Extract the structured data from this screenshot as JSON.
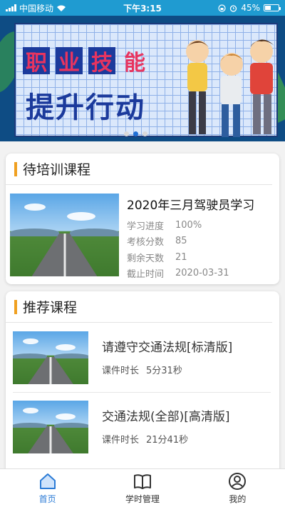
{
  "status_bar": {
    "carrier": "中国移动",
    "time": "下午3:15",
    "battery_percent": "45%",
    "battery_level": 0.45,
    "icons": [
      "signal-icon",
      "wifi-icon",
      "screen-lock-icon",
      "alarm-icon",
      "battery-icon"
    ]
  },
  "banner": {
    "title_line1_chars": [
      "职",
      "业",
      "技",
      "能"
    ],
    "title_line2": "提升行动",
    "carousel_pages": 3,
    "carousel_active": 2
  },
  "pending": {
    "section_title": "待培训课程",
    "course": {
      "title": "2020年三月驾驶员学习",
      "rows": [
        {
          "label": "学习进度",
          "value": "100%"
        },
        {
          "label": "考核分数",
          "value": "85"
        },
        {
          "label": "剩余天数",
          "value": "21"
        },
        {
          "label": "截止时间",
          "value": "2020-03-31"
        }
      ]
    }
  },
  "recommend": {
    "section_title": "推荐课程",
    "items": [
      {
        "title": "请遵守交通法规[标清版]",
        "duration_label": "课件时长",
        "duration": "5分31秒"
      },
      {
        "title": "交通法规(全部)[高清版]",
        "duration_label": "课件时长",
        "duration": "21分41秒"
      }
    ]
  },
  "tabbar": {
    "tabs": [
      {
        "label": "首页",
        "icon": "home-icon",
        "active": true
      },
      {
        "label": "学时管理",
        "icon": "book-icon",
        "active": false
      },
      {
        "label": "我的",
        "icon": "profile-icon",
        "active": false
      }
    ]
  },
  "colors": {
    "status_bar": "#1f9bd1",
    "accent_bar": "#f0a020",
    "tab_active": "#2b7bd6",
    "banner_title": "#1b3a9c",
    "banner_title_box_text": "#e8345f"
  }
}
